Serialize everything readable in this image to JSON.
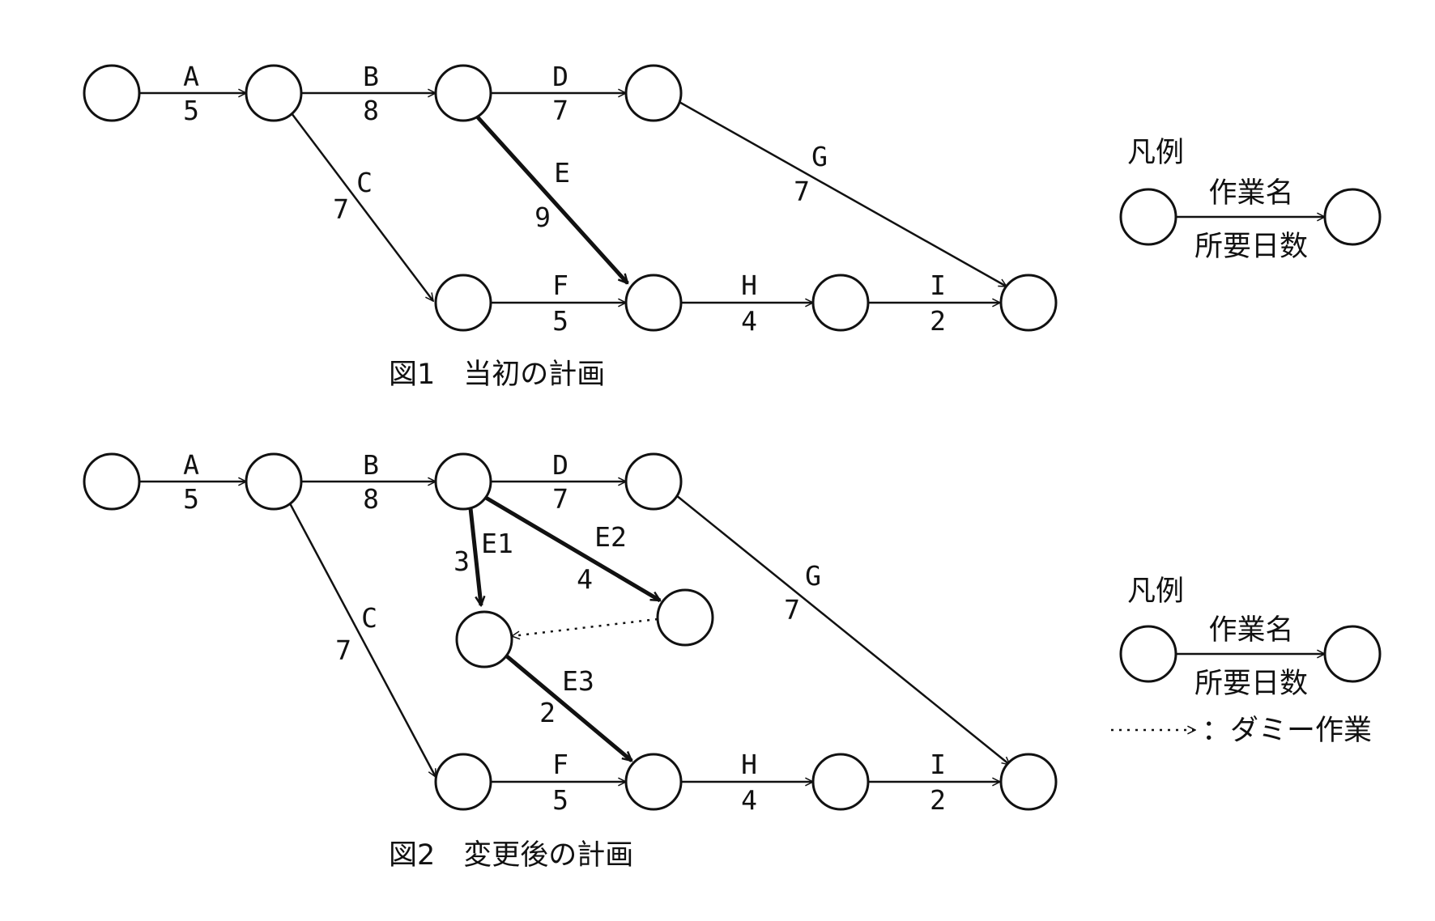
{
  "figure1": {
    "caption": "図1　当初の計画",
    "activities": [
      {
        "id": "A",
        "name": "A",
        "duration": "5"
      },
      {
        "id": "B",
        "name": "B",
        "duration": "8"
      },
      {
        "id": "C",
        "name": "C",
        "duration": "7"
      },
      {
        "id": "D",
        "name": "D",
        "duration": "7"
      },
      {
        "id": "E",
        "name": "E",
        "duration": "9",
        "critical": true
      },
      {
        "id": "F",
        "name": "F",
        "duration": "5"
      },
      {
        "id": "G",
        "name": "G",
        "duration": "7"
      },
      {
        "id": "H",
        "name": "H",
        "duration": "4"
      },
      {
        "id": "I",
        "name": "I",
        "duration": "2"
      }
    ],
    "legend": {
      "title": "凡例",
      "activity_name": "作業名",
      "duration": "所要日数"
    }
  },
  "figure2": {
    "caption": "図2　変更後の計画",
    "activities": [
      {
        "id": "A",
        "name": "A",
        "duration": "5"
      },
      {
        "id": "B",
        "name": "B",
        "duration": "8"
      },
      {
        "id": "C",
        "name": "C",
        "duration": "7"
      },
      {
        "id": "D",
        "name": "D",
        "duration": "7"
      },
      {
        "id": "E1",
        "name": "E1",
        "duration": "3",
        "critical": true
      },
      {
        "id": "E2",
        "name": "E2",
        "duration": "4",
        "critical": true
      },
      {
        "id": "E3",
        "name": "E3",
        "duration": "2",
        "critical": true
      },
      {
        "id": "F",
        "name": "F",
        "duration": "5"
      },
      {
        "id": "G",
        "name": "G",
        "duration": "7"
      },
      {
        "id": "H",
        "name": "H",
        "duration": "4"
      },
      {
        "id": "I",
        "name": "I",
        "duration": "2"
      }
    ],
    "legend": {
      "title": "凡例",
      "activity_name": "作業名",
      "duration": "所要日数",
      "dummy_label": "：ダミー作業"
    }
  }
}
